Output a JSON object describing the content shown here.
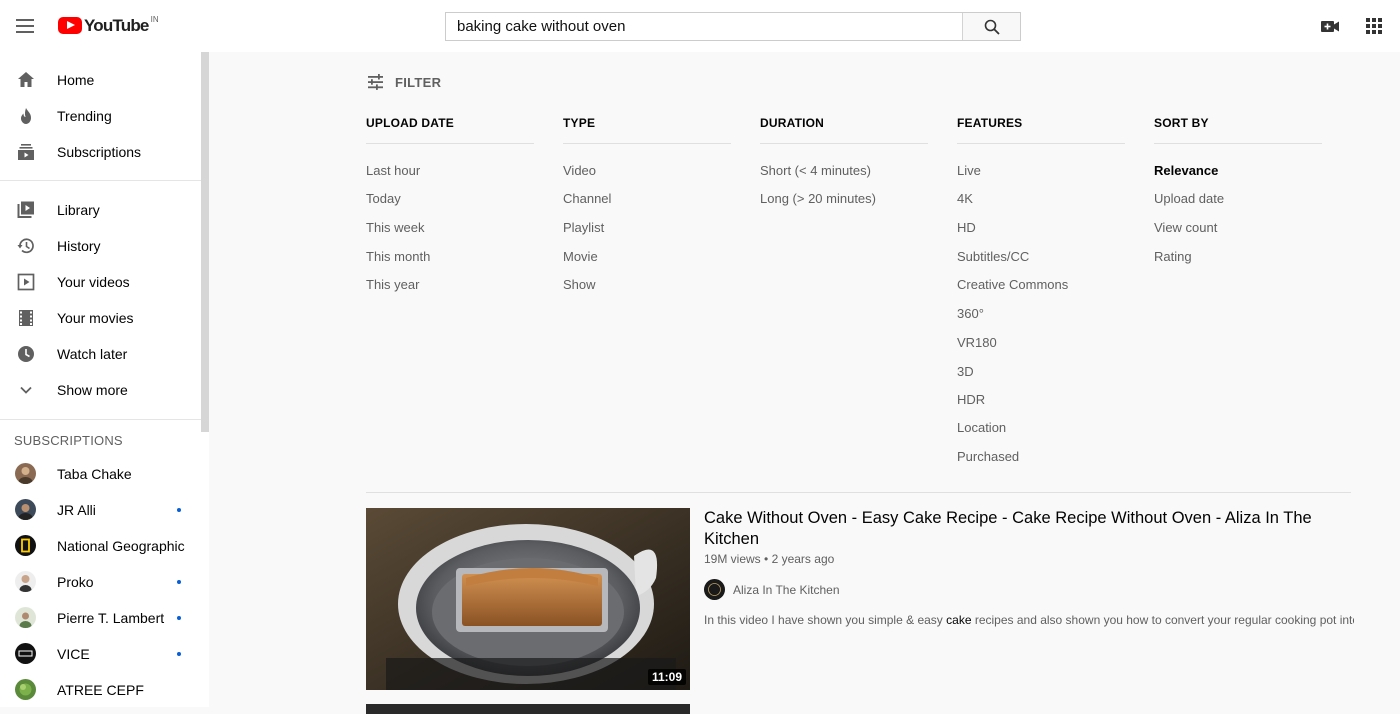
{
  "header": {
    "logo_text": "YouTube",
    "country_code": "IN",
    "search_value": "baking cake without oven"
  },
  "sidebar": {
    "main": [
      {
        "label": "Home",
        "icon": "home-icon"
      },
      {
        "label": "Trending",
        "icon": "flame-icon"
      },
      {
        "label": "Subscriptions",
        "icon": "subscriptions-icon"
      }
    ],
    "library": [
      {
        "label": "Library",
        "icon": "library-icon"
      },
      {
        "label": "History",
        "icon": "history-icon"
      },
      {
        "label": "Your videos",
        "icon": "your-videos-icon"
      },
      {
        "label": "Your movies",
        "icon": "film-icon"
      },
      {
        "label": "Watch later",
        "icon": "clock-icon"
      },
      {
        "label": "Show more",
        "icon": "chevron-down-icon"
      }
    ],
    "subscriptions_heading": "SUBSCRIPTIONS",
    "subscriptions": [
      {
        "label": "Taba Chake",
        "new": false,
        "color": "#8a6a52"
      },
      {
        "label": "JR Alli",
        "new": true,
        "color": "#3c4a5a"
      },
      {
        "label": "National Geographic",
        "new": false,
        "color": "#111111"
      },
      {
        "label": "Proko",
        "new": true,
        "color": "#d9c4b0"
      },
      {
        "label": "Pierre T. Lambert",
        "new": true,
        "color": "#6a8a5a"
      },
      {
        "label": "VICE",
        "new": true,
        "color": "#111111"
      },
      {
        "label": "ATREE CEPF",
        "new": false,
        "color": "#5a8a3a"
      }
    ]
  },
  "filter": {
    "toggle_label": "FILTER",
    "columns": [
      {
        "heading": "UPLOAD DATE",
        "options": [
          "Last hour",
          "Today",
          "This week",
          "This month",
          "This year"
        ]
      },
      {
        "heading": "TYPE",
        "options": [
          "Video",
          "Channel",
          "Playlist",
          "Movie",
          "Show"
        ]
      },
      {
        "heading": "DURATION",
        "options": [
          "Short (< 4 minutes)",
          "Long (> 20 minutes)"
        ]
      },
      {
        "heading": "FEATURES",
        "options": [
          "Live",
          "4K",
          "HD",
          "Subtitles/CC",
          "Creative Commons",
          "360°",
          "VR180",
          "3D",
          "HDR",
          "Location",
          "Purchased"
        ]
      },
      {
        "heading": "SORT BY",
        "options": [
          "Relevance",
          "Upload date",
          "View count",
          "Rating"
        ],
        "active": "Relevance"
      }
    ]
  },
  "result": {
    "title": "Cake Without Oven - Easy Cake Recipe - Cake Recipe Without Oven - Aliza In The Kitchen",
    "views": "19M views",
    "age": "2 years ago",
    "channel": "Aliza In The Kitchen",
    "description_before": "In this video I have shown you simple & easy ",
    "description_highlight": "cake",
    "description_after": " recipes and also shown you how to convert your regular cooking pot into ...",
    "duration": "11:09",
    "thumb_caption": "Aliza In The Kitchen"
  },
  "colors": {
    "brand_red": "#ff0000",
    "subscription_dot": "#065fd4"
  }
}
